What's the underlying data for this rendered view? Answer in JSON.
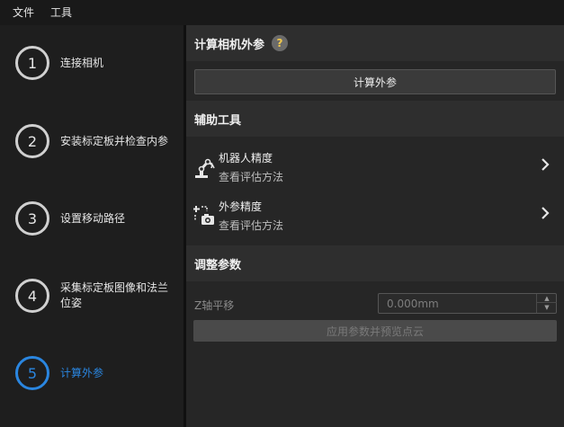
{
  "menu": {
    "file": "文件",
    "tools": "工具"
  },
  "steps": [
    {
      "number": "1",
      "label": "连接相机"
    },
    {
      "number": "2",
      "label": "安装标定板并检查内参"
    },
    {
      "number": "3",
      "label": "设置移动路径"
    },
    {
      "number": "4",
      "label": "采集标定板图像和法兰位姿"
    },
    {
      "number": "5",
      "label": "计算外参"
    }
  ],
  "calc": {
    "title": "计算相机外参",
    "help": "?",
    "button": "计算外参"
  },
  "aux": {
    "title": "辅助工具",
    "robot": {
      "title": "机器人精度",
      "sub": "查看评估方法"
    },
    "extrinsic": {
      "title": "外参精度",
      "sub": "查看评估方法"
    }
  },
  "adjust": {
    "title": "调整参数",
    "z_label": "Z轴平移",
    "z_value": "0.000mm",
    "apply_button": "应用参数并预览点云"
  },
  "colors": {
    "accent": "#2a86e0",
    "help_q": "#f2c94c"
  }
}
